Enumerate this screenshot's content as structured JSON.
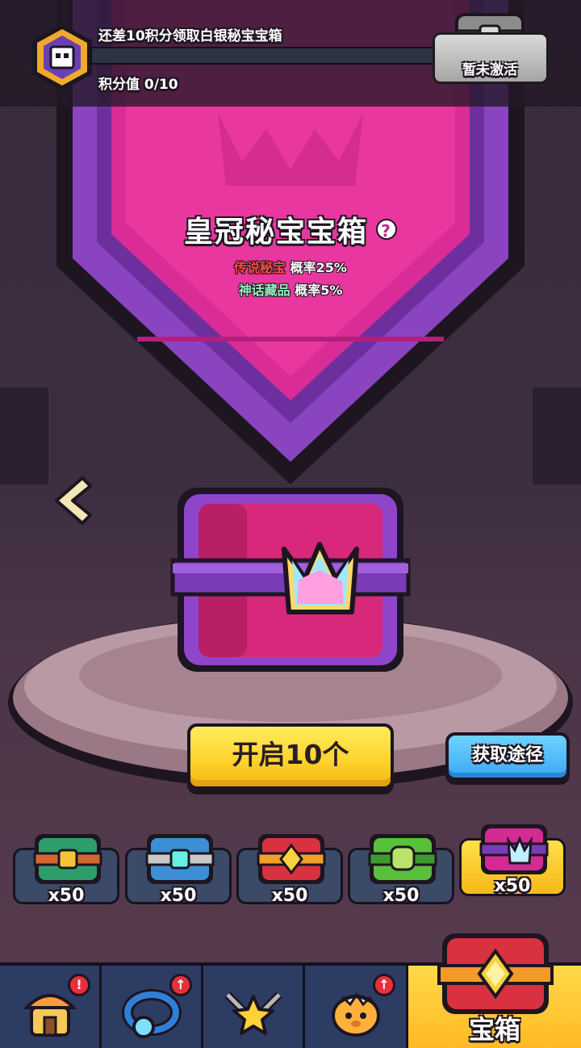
{
  "top_bar": {
    "progress_title": "还差10积分领取白银秘宝宝箱",
    "points_label": "积分值 0/10",
    "points_fill": 0,
    "inactive_label": "暂未激活"
  },
  "chest": {
    "title": "皇冠秘宝宝箱",
    "help": "?",
    "rates": [
      {
        "name": "传说秘宝",
        "text": "概率25%"
      },
      {
        "name": "神话藏品",
        "text": "概率5%"
      }
    ]
  },
  "actions": {
    "open_label": "开启10个",
    "source_label": "获取途径"
  },
  "selector": {
    "slots": [
      {
        "count": "x50",
        "color": "#2f9d6a"
      },
      {
        "count": "x50",
        "color": "#3c8fd6"
      },
      {
        "count": "x50",
        "color": "#d8313f"
      },
      {
        "count": "x50",
        "color": "#58c03b"
      },
      {
        "count": "x50",
        "color": "#d42b93"
      }
    ],
    "active_index": 4
  },
  "bottom_nav": {
    "items": [
      {
        "icon": "shop-icon",
        "badge": "!"
      },
      {
        "icon": "ring-icon",
        "badge": "↑"
      },
      {
        "icon": "star-weapons-icon",
        "badge": ""
      },
      {
        "icon": "pet-egg-icon",
        "badge": "↑"
      },
      {
        "icon": "chest-icon",
        "label": "宝箱"
      }
    ]
  },
  "colors": {
    "accent_yellow": "#ffd22b",
    "banner_pink": "#d42b93",
    "banner_purple": "#8b3fbf",
    "button_blue": "#3aa8f5"
  }
}
